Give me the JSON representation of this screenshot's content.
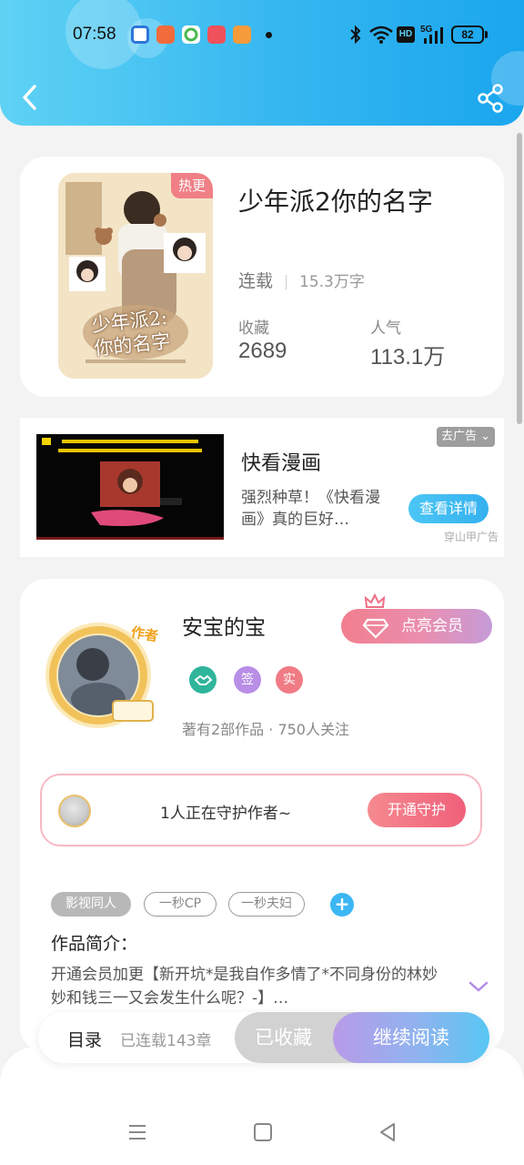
{
  "status_bar": {
    "time": "07:58",
    "network": "5G",
    "battery": "82",
    "hd": "HD"
  },
  "header": {
    "back_icon": "chevron-left-icon",
    "share_icon": "share-icon"
  },
  "book": {
    "title": "少年派2你的名字",
    "cover_badge": "热更",
    "cover_title": "少年派2:\n你的名字",
    "status": "连载",
    "word_count": "15.3万字",
    "favorites_label": "收藏",
    "favorites_value": "2689",
    "popularity_label": "人气",
    "popularity_value": "113.1万"
  },
  "ad": {
    "skip_label": "去广告",
    "title": "快看漫画",
    "description": "强烈种草！《快看漫画》真的巨好…",
    "button": "查看详情",
    "source": "穿山甲广告"
  },
  "author": {
    "avatar_badge": "作者",
    "name": "安宝的宝",
    "vip_button": "点亮会员",
    "badges": [
      "签",
      "实"
    ],
    "meta": "著有2部作品 · 750人关注",
    "guard_text": "1人正在守护作者~",
    "guard_button": "开通守护"
  },
  "tags": [
    "影视同人",
    "一秒CP",
    "一秒夫妇"
  ],
  "intro": {
    "label": "作品简介：",
    "text": "开通会员加更【新开坑*是我自作多情了*不同身份的林妙妙和钱三一又会发生什么呢？-】…"
  },
  "actions": {
    "toc": "目录",
    "chapters": "已连载143章",
    "collected": "已收藏",
    "continue": "继续阅读"
  },
  "colors": {
    "header_blue": "#35b6f0",
    "accent_pink": "#f0607a",
    "tag_blue": "#3cb7f3"
  }
}
